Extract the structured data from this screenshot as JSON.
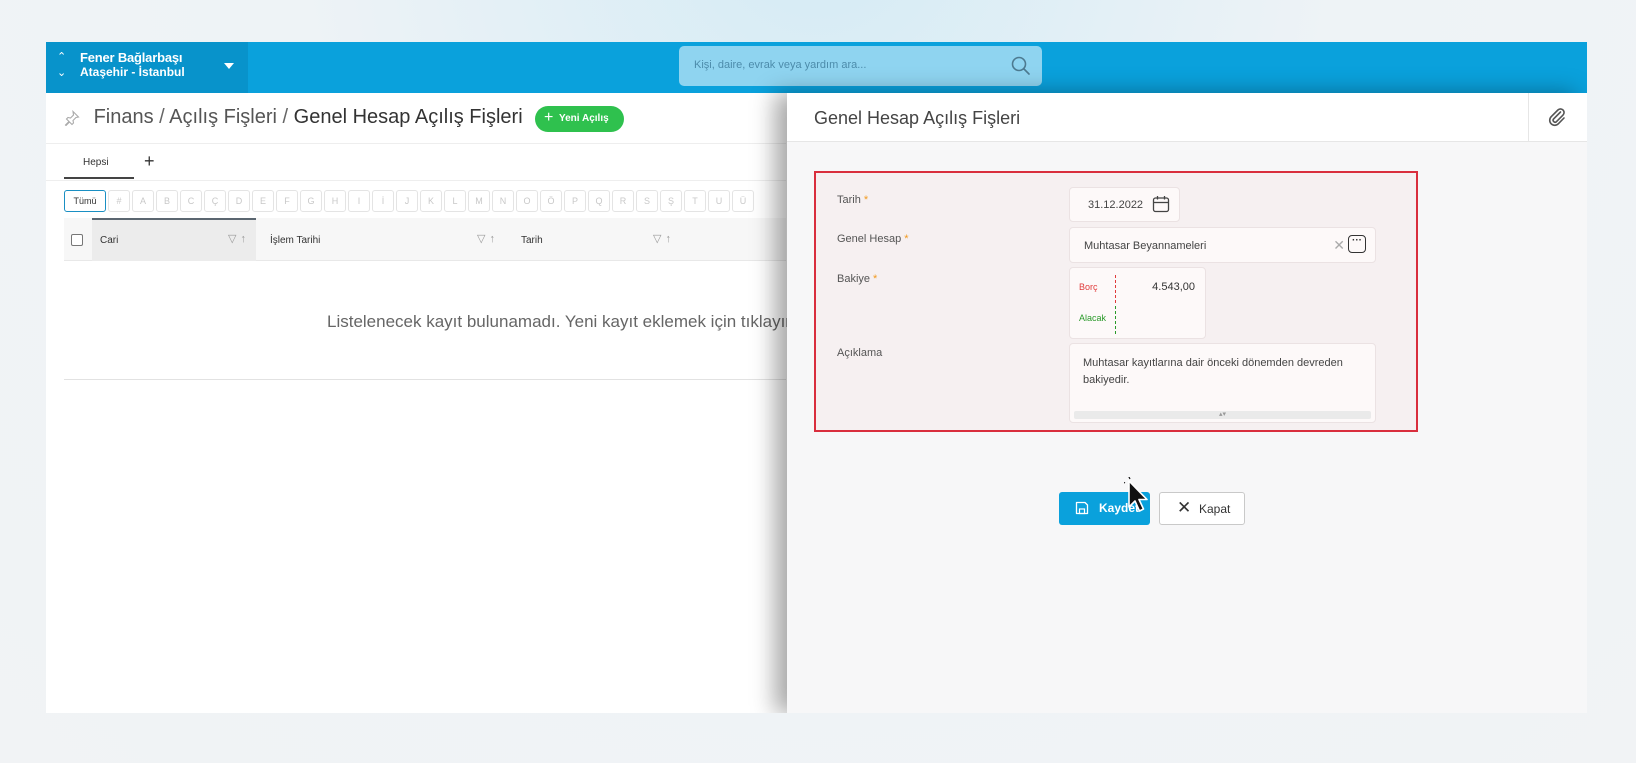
{
  "topbar": {
    "company_name": "Fener Bağlarbaşı",
    "company_location": "Ataşehir - İstanbul",
    "search_placeholder": "Kişi, daire, evrak veya yardım ara..."
  },
  "breadcrumb": {
    "part1": "Finans",
    "sep": "/",
    "part2": "Açılış Fişleri",
    "current": "Genel Hesap Açılış Fişleri"
  },
  "new_button_label": "Yeni Açılış",
  "tabs": [
    {
      "label": "Hepsi"
    }
  ],
  "tab_add_label": "+",
  "letter_filter": [
    "Tümü",
    "#",
    "A",
    "B",
    "C",
    "Ç",
    "D",
    "E",
    "F",
    "G",
    "H",
    "I",
    "İ",
    "J",
    "K",
    "L",
    "M",
    "N",
    "O",
    "Ö",
    "P",
    "Q",
    "R",
    "S",
    "Ş",
    "T",
    "U",
    "Ü"
  ],
  "grid": {
    "columns": [
      "Cari",
      "İşlem Tarihi",
      "Tarih"
    ],
    "empty_message": "Listelenecek kayıt bulunamadı. Yeni kayıt eklemek için tıklayın"
  },
  "panel": {
    "title": "Genel Hesap Açılış Fişleri",
    "form": {
      "date_label": "Tarih",
      "date_value": "31.12.2022",
      "account_label": "Genel Hesap",
      "account_value": "Muhtasar Beyannameleri",
      "balance_label": "Bakiye",
      "debit_label": "Borç",
      "debit_value": "4.543,00",
      "credit_label": "Alacak",
      "credit_value": "",
      "description_label": "Açıklama",
      "description_value": "Muhtasar kayıtlarına dair önceki dönemden devreden bakiyedir.",
      "required_marker": "*"
    },
    "save_label": "Kaydet",
    "close_label": "Kapat"
  },
  "colors": {
    "topbar": "#0aa1dc",
    "company_bg": "#0893cb",
    "new_button": "#2fc14e",
    "form_border": "#d92e3d",
    "save_button": "#0aa1dc",
    "debit": "#e03b3b",
    "credit": "#2a9a2a"
  },
  "icons": [
    "chevron-up-icon",
    "chevron-down-icon",
    "caret-down-icon",
    "search-icon",
    "pin-icon",
    "plus-icon",
    "filter-icon",
    "sort-icon",
    "paperclip-icon",
    "calendar-icon",
    "clear-icon",
    "more-icon",
    "save-icon",
    "close-icon",
    "cursor-icon"
  ]
}
